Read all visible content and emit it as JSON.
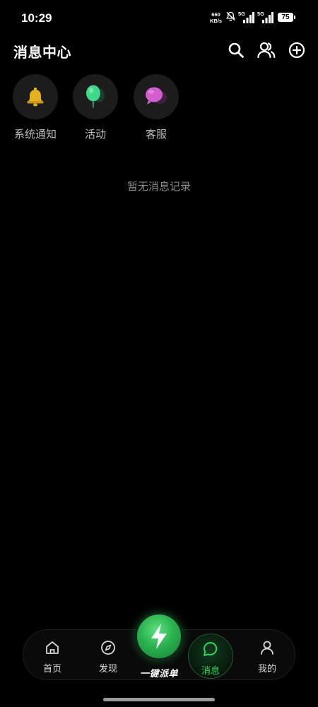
{
  "status_bar": {
    "time": "10:29",
    "net_speed_value": "660",
    "net_speed_unit": "KB/s",
    "sim1_label": "5G",
    "sim2_label": "5G",
    "battery": "75"
  },
  "header": {
    "title": "消息中心",
    "icons": [
      "search-icon",
      "contacts-icon",
      "add-circle-icon"
    ]
  },
  "categories": [
    {
      "label": "系统通知",
      "icon": "bell-icon",
      "color": "#e5b21f"
    },
    {
      "label": "活动",
      "icon": "balloon-icon",
      "color": "#3fd88a"
    },
    {
      "label": "客服",
      "icon": "chat-bubble-icon",
      "color": "#d35fcf"
    }
  ],
  "empty_state": "暂无消息记录",
  "bottom_nav": {
    "items": [
      {
        "label": "首页",
        "icon": "home-icon"
      },
      {
        "label": "发现",
        "icon": "compass-icon"
      },
      {
        "label": "消息",
        "icon": "message-icon",
        "active": true
      },
      {
        "label": "我的",
        "icon": "person-icon"
      }
    ],
    "dispatch_label": "一键派单",
    "accent": "#2ed85f"
  }
}
